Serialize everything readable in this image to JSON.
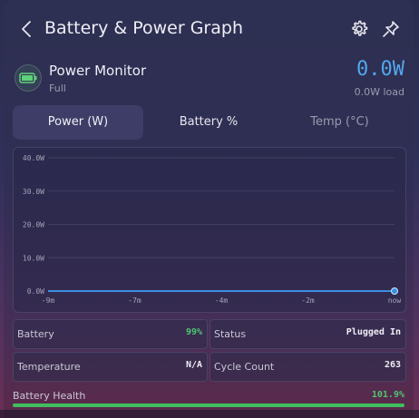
{
  "header": {
    "title": "Battery & Power Graph",
    "back_icon": "chevron-left-icon",
    "settings_icon": "gear-icon",
    "pin_icon": "pin-icon"
  },
  "monitor": {
    "title": "Power Monitor",
    "subtitle": "Full",
    "watts": "0.0W",
    "load": "0.0W load",
    "icon": "battery-full-icon",
    "accent": "#52a7ee"
  },
  "tabs": [
    {
      "label": "Power (W)",
      "active": true
    },
    {
      "label": "Battery %",
      "active": false
    },
    {
      "label": "Temp (°C)",
      "active": false
    }
  ],
  "chart_data": {
    "type": "line",
    "x_labels": [
      "-9m",
      "-7m",
      "-4m",
      "-2m",
      "now"
    ],
    "y_labels": [
      "40.0W",
      "30.0W",
      "20.0W",
      "10.0W",
      "0.0W"
    ],
    "ylim": [
      0,
      40
    ],
    "series": [
      {
        "values": [
          0.0,
          0.0,
          0.0,
          0.0,
          0.0
        ],
        "color": "#3a8fe0"
      }
    ],
    "grid": true
  },
  "stats": {
    "battery": {
      "label": "Battery",
      "value": "99%"
    },
    "status": {
      "label": "Status",
      "value": "Plugged In"
    },
    "temperature": {
      "label": "Temperature",
      "value": "N/A"
    },
    "cycle_count": {
      "label": "Cycle Count",
      "value": "263"
    }
  },
  "health": {
    "label": "Battery Health",
    "value": "101.9%",
    "fill_fraction": 1.0,
    "color": "#3fbf5f"
  }
}
